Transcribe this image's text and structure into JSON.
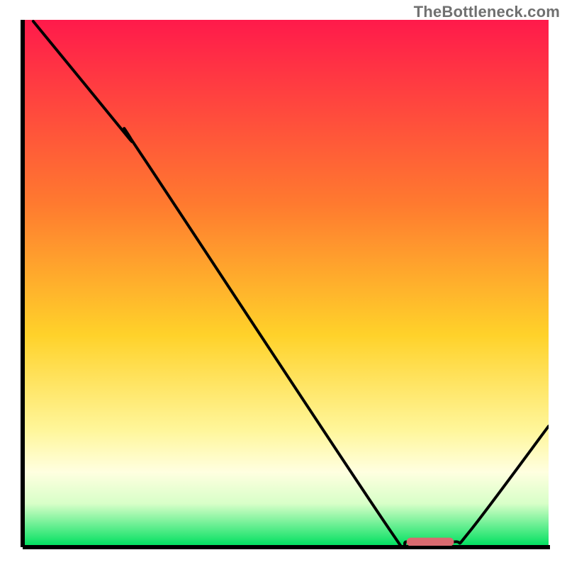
{
  "attribution": "TheBottleneck.com",
  "chart_data": {
    "type": "line",
    "title": "",
    "xlabel": "",
    "ylabel": "",
    "xlim": [
      0,
      100
    ],
    "ylim": [
      0,
      100
    ],
    "gradient_stops": [
      {
        "offset": 0,
        "color": "#ff1a4b"
      },
      {
        "offset": 35,
        "color": "#ff7a2f"
      },
      {
        "offset": 60,
        "color": "#ffd22a"
      },
      {
        "offset": 78,
        "color": "#fff69a"
      },
      {
        "offset": 86,
        "color": "#ffffe0"
      },
      {
        "offset": 92,
        "color": "#d8ffc8"
      },
      {
        "offset": 100,
        "color": "#00e060"
      }
    ],
    "series": [
      {
        "name": "bottleneck-curve",
        "color": "#000000",
        "points": [
          {
            "x": 2,
            "y": 100
          },
          {
            "x": 20,
            "y": 78
          },
          {
            "x": 23,
            "y": 74
          },
          {
            "x": 70,
            "y": 3
          },
          {
            "x": 73,
            "y": 1
          },
          {
            "x": 82,
            "y": 1
          },
          {
            "x": 85,
            "y": 3
          },
          {
            "x": 100,
            "y": 23
          }
        ]
      }
    ],
    "optimal_marker": {
      "x_start": 73,
      "x_end": 82,
      "y": 1,
      "color": "#d96a6f"
    }
  }
}
